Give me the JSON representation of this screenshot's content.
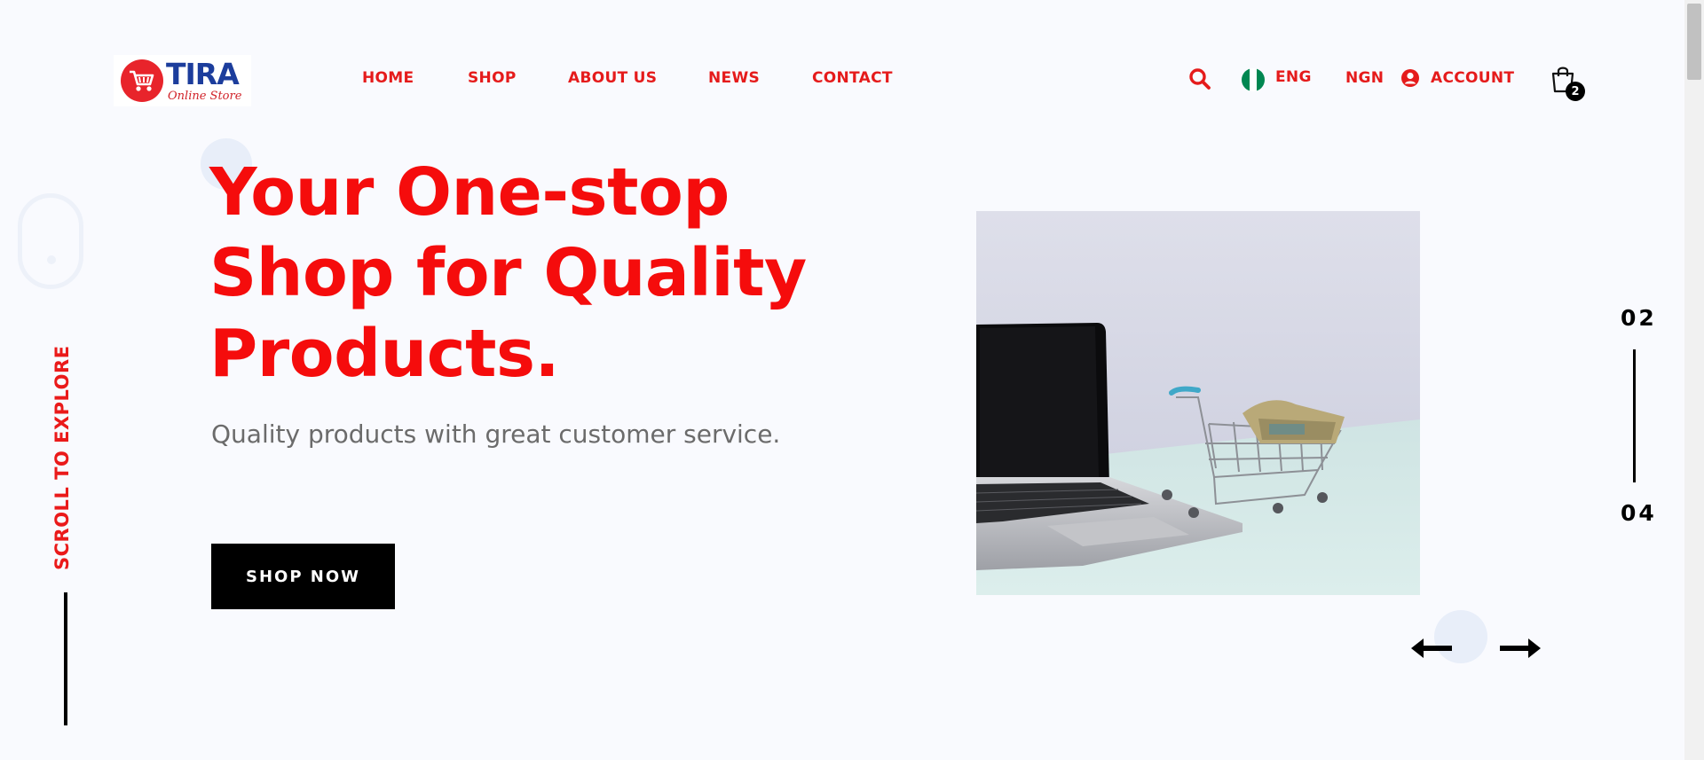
{
  "header": {
    "logo": {
      "name": "TIRA",
      "subtitle": "Online Store"
    },
    "nav": [
      "HOME",
      "SHOP",
      "ABOUT US",
      "NEWS",
      "CONTACT"
    ],
    "language": "ENG",
    "currency": "NGN",
    "account": "ACCOUNT",
    "cart_count": "2"
  },
  "hero": {
    "title_line1": "Your One-stop",
    "title_line2": "Shop for Quality",
    "title_line3": "Products.",
    "subtitle": "Quality products with great customer service.",
    "cta": "SHOP NOW",
    "scroll_label": "SCROLL TO EXPLORE"
  },
  "pager": {
    "current": "02",
    "total": "04"
  },
  "colors": {
    "accent": "#f50c0c",
    "brand_blue": "#1c3d9c",
    "button": "#000000"
  },
  "icons": [
    "search-icon",
    "nigeria-flag-icon",
    "user-circle-icon",
    "shopping-bag-icon",
    "arrow-left-icon",
    "arrow-right-icon",
    "mouse-scroll-icon"
  ]
}
